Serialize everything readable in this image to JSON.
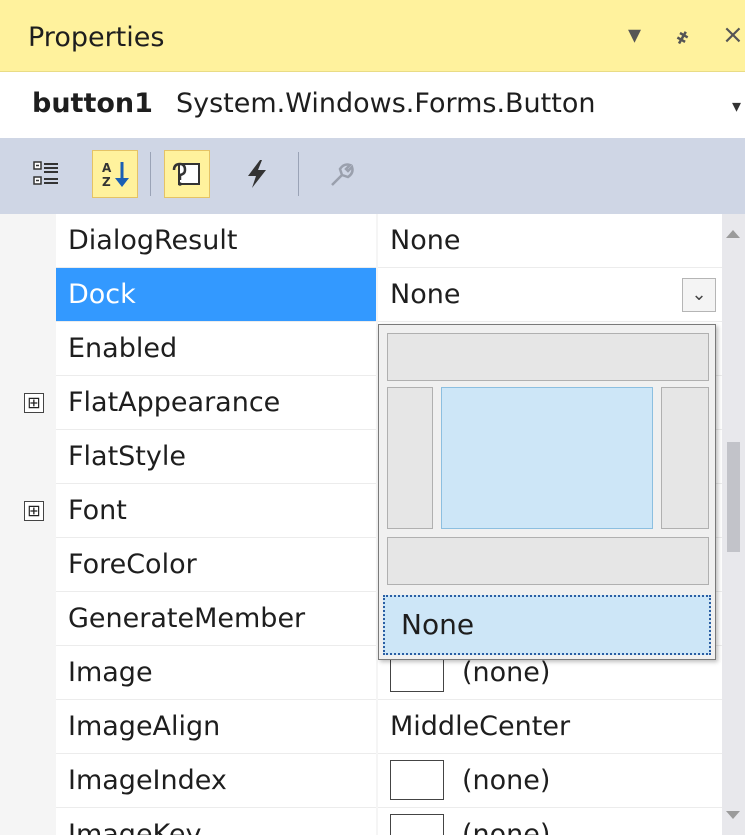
{
  "panel": {
    "title": "Properties",
    "dropdown_icon": "caret-down-icon",
    "pin_icon": "pin-icon",
    "close_icon": "close-icon",
    "pin_glyph": "҂",
    "close_glyph": "×",
    "caret_glyph": "▾"
  },
  "object_selector": {
    "name": "button1",
    "type": "System.Windows.Forms.Button",
    "caret": "▾"
  },
  "toolbar": {
    "buttons": [
      {
        "name": "categorized-icon",
        "checked": false
      },
      {
        "name": "alphabetical-icon",
        "checked": true
      },
      {
        "name": "properties-icon",
        "checked": true
      },
      {
        "name": "events-icon",
        "checked": false
      },
      {
        "name": "property-pages-icon",
        "checked": false,
        "disabled": true
      }
    ]
  },
  "grid": {
    "rows": [
      {
        "name": "DialogResult",
        "value": "None"
      },
      {
        "name": "Dock",
        "value": "None",
        "selected": true,
        "dropdown": "⌄"
      },
      {
        "name": "Enabled",
        "value": ""
      },
      {
        "name": "FlatAppearance",
        "value": "",
        "expander": "⊞"
      },
      {
        "name": "FlatStyle",
        "value": ""
      },
      {
        "name": "Font",
        "value": "",
        "expander": "⊞"
      },
      {
        "name": "ForeColor",
        "value": ""
      },
      {
        "name": "GenerateMember",
        "value": ""
      },
      {
        "name": "Image",
        "value": "(none)",
        "swatch": true
      },
      {
        "name": "ImageAlign",
        "value": "MiddleCenter"
      },
      {
        "name": "ImageIndex",
        "value": "(none)",
        "swatch": true
      },
      {
        "name": "ImageKey",
        "value": "(none)",
        "swatch": true
      }
    ]
  },
  "dock_popup": {
    "none_label": "None",
    "colors": {
      "fill": "#cde6f7",
      "edge": "#e6e6e6",
      "focus": "#2a5ea3"
    }
  },
  "colors": {
    "title_bar": "#fff29d",
    "toolbar": "#cfd6e5",
    "selection": "#3399ff"
  }
}
